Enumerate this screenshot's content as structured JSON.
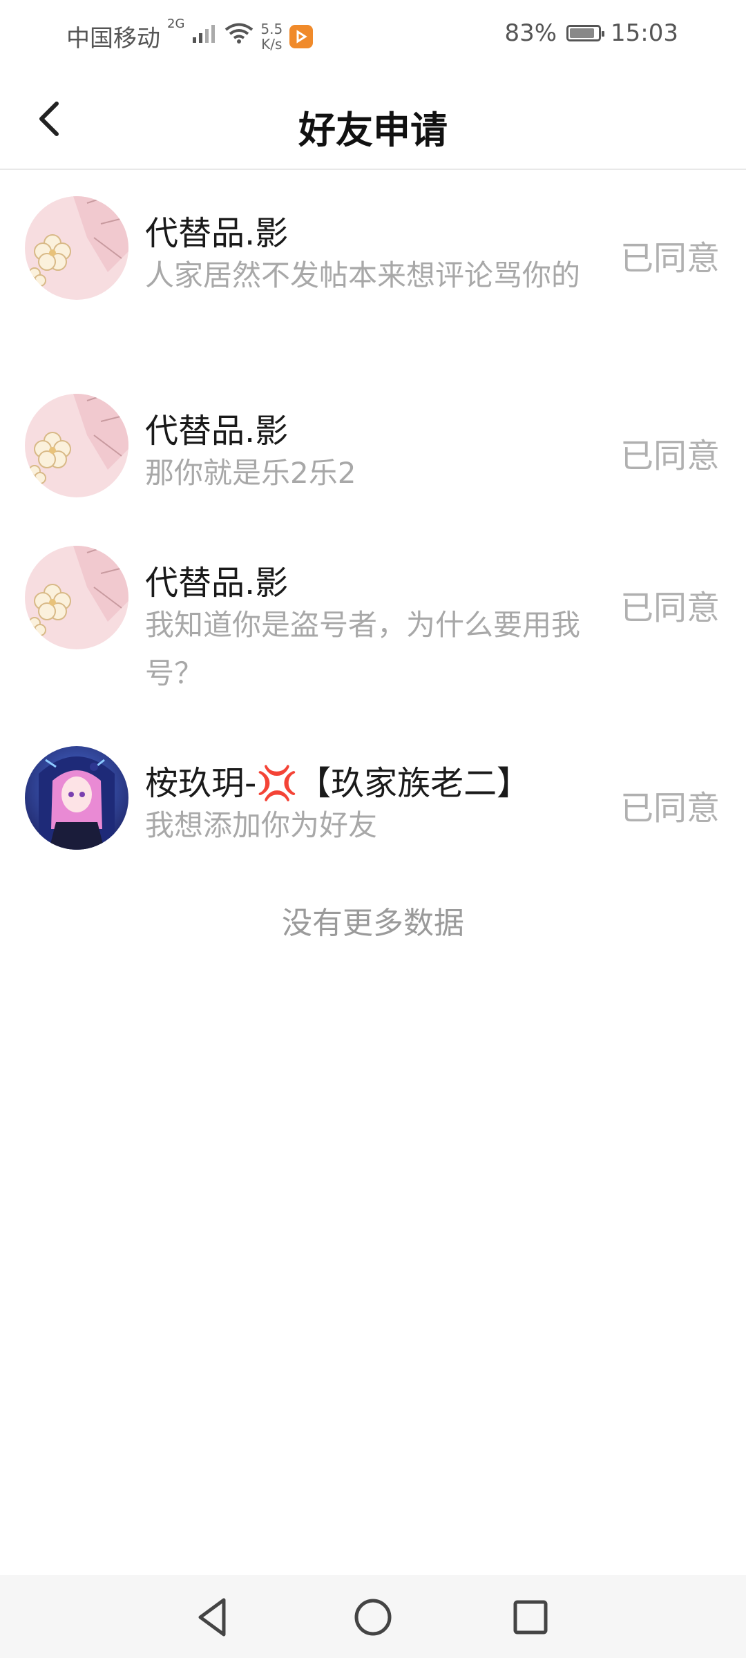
{
  "status_bar": {
    "carrier": "中国移动",
    "network_type": "2G",
    "speed_value": "5.5",
    "speed_unit": "K/s",
    "battery": "83%",
    "time": "15:03",
    "icons": [
      "signal-icon",
      "wifi-icon",
      "app-notification-icon",
      "battery-icon"
    ]
  },
  "header": {
    "title": "好友申请",
    "back_icon": "chevron-left-icon"
  },
  "requests": [
    {
      "name": "代替品.影",
      "message": "人家居然不发帖本来想评论骂你的",
      "status": "已同意",
      "avatar": "pink-flower-avatar"
    },
    {
      "name": "代替品.影",
      "message": "那你就是乐2乐2",
      "status": "已同意",
      "avatar": "pink-flower-avatar"
    },
    {
      "name": "代替品.影",
      "message": "我知道你是盗号者，为什么要用我号？",
      "status": "已同意",
      "avatar": "pink-flower-avatar"
    },
    {
      "name": "桉玖玥-",
      "name_suffix": "【玖家族老二】",
      "emoji": "💢",
      "message": "我想添加你为好友",
      "status": "已同意",
      "avatar": "anime-girl-avatar"
    }
  ],
  "footer_text": "没有更多数据",
  "nav_bar": {
    "icons": [
      "back-triangle-icon",
      "home-circle-icon",
      "recents-square-icon"
    ]
  },
  "colors": {
    "accent_orange": "#f08a2a",
    "muted_text": "#a8a8a8",
    "title_text": "#111111"
  }
}
